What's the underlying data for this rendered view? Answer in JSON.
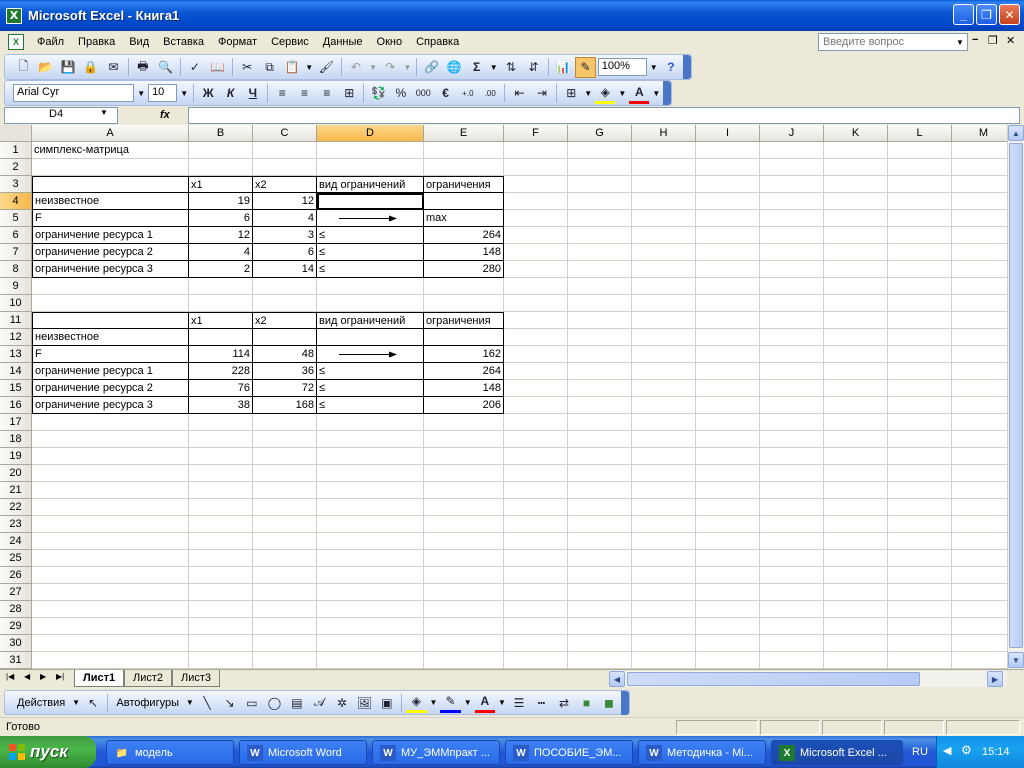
{
  "window": {
    "title": "Microsoft Excel - Книга1",
    "app_icon": "X"
  },
  "menu": {
    "items": [
      "Файл",
      "Правка",
      "Вид",
      "Вставка",
      "Формат",
      "Сервис",
      "Данные",
      "Окно",
      "Справка"
    ],
    "help_placeholder": "Введите вопрос"
  },
  "toolbar": {
    "zoom": "100%",
    "font_name": "Arial Cyr",
    "font_size": "10",
    "bold_label": "Ж",
    "italic_label": "К",
    "underline_label": "Ч",
    "percent_label": "%",
    "thousands_label": "000",
    "currency_label": "€",
    "sum_label": "Σ"
  },
  "formula_bar": {
    "cell_ref": "D4",
    "fx": "fx",
    "content": ""
  },
  "columns": [
    "A",
    "B",
    "C",
    "D",
    "E",
    "F",
    "G",
    "H",
    "I",
    "J",
    "K",
    "L",
    "M"
  ],
  "rows": [
    "1",
    "2",
    "3",
    "4",
    "5",
    "6",
    "7",
    "8",
    "9",
    "10",
    "11",
    "12",
    "13",
    "14",
    "15",
    "16",
    "17",
    "18",
    "19",
    "20",
    "21",
    "22",
    "23",
    "24",
    "25",
    "26",
    "27",
    "28",
    "29",
    "30",
    "31"
  ],
  "cells": {
    "A1": "симплекс-матрица",
    "B3": "x1",
    "C3": "x2",
    "D3": "вид ограничений",
    "E3": "ограничения",
    "A4": "неизвестное",
    "B4": "19",
    "C4": "12",
    "A5": "F",
    "B5": "6",
    "C5": "4",
    "E5": "max",
    "A6": "ограничение ресурса 1",
    "B6": "12",
    "C6": "3",
    "D6": "≤",
    "E6": "264",
    "A7": "ограничение ресурса 2",
    "B7": "4",
    "C7": "6",
    "D7": "≤",
    "E7": "148",
    "A8": "ограничение ресурса 3",
    "B8": "2",
    "C8": "14",
    "D8": "≤",
    "E8": "280",
    "B11": "x1",
    "C11": "x2",
    "D11": "вид ограничений",
    "E11": "ограничения",
    "A12": "неизвестное",
    "A13": "F",
    "B13": "114",
    "C13": "48",
    "E13": "162",
    "A14": "ограничение ресурса 1",
    "B14": "228",
    "C14": "36",
    "D14": "≤",
    "E14": "264",
    "A15": "ограничение ресурса 2",
    "B15": "76",
    "C15": "72",
    "D15": "≤",
    "E15": "148",
    "A16": "ограничение ресурса 3",
    "B16": "38",
    "C16": "168",
    "D16": "≤",
    "E16": "206"
  },
  "sheets": [
    "Лист1",
    "Лист2",
    "Лист3"
  ],
  "draw_toolbar": {
    "actions_label": "Действия",
    "autoshapes_label": "Автофигуры"
  },
  "status": {
    "text": "Готово"
  },
  "taskbar": {
    "start_label": "пуск",
    "items": [
      "модель",
      "Microsoft Word",
      "МУ_ЭММпракт ...",
      "ПОСОБИЕ_ЭМ...",
      "Методичка - Mi...",
      "Microsoft Excel ..."
    ],
    "lang": "RU",
    "clock": "15:14"
  },
  "colors": {
    "selected_header": "#f7b74a",
    "title_blue": "#0046c8",
    "taskbar_blue": "#2157d7",
    "start_green": "#3c9a3c"
  }
}
